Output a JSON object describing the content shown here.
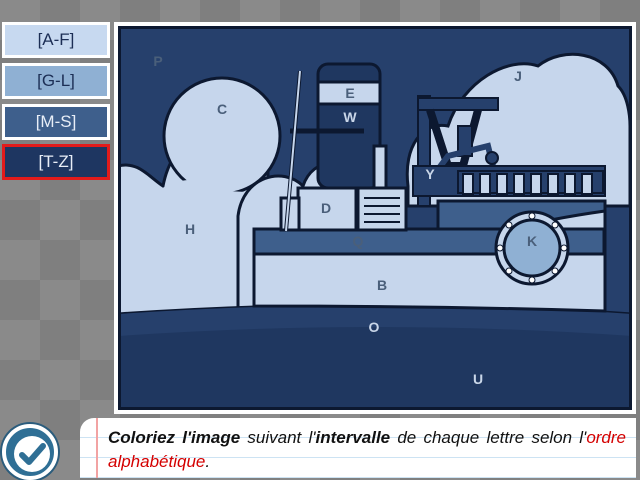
{
  "palette": {
    "buttons": [
      {
        "label": "[A-F]",
        "bg": "#c7d9f0",
        "fg": "#1c2e55",
        "border": "#ffffff"
      },
      {
        "label": "[G-L]",
        "bg": "#8fb0d3",
        "fg": "#1c2e55",
        "border": "#ffffff"
      },
      {
        "label": "[M-S]",
        "bg": "#3e5f8c",
        "fg": "#e8eef7",
        "border": "#ffffff"
      },
      {
        "label": "[T-Z]",
        "bg": "#1e3661",
        "fg": "#e8eef7",
        "border": "#e21b1b"
      }
    ],
    "selected_index": 3
  },
  "drawing": {
    "labels": {
      "P": "P",
      "C": "C",
      "E": "E",
      "W": "W",
      "J": "J",
      "Y": "Y",
      "H": "H",
      "D": "D",
      "Q": "Q",
      "K": "K",
      "B": "B",
      "O": "O",
      "U": "U"
    }
  },
  "colors": {
    "outline": "#0c1830",
    "sky": "#26406c",
    "cloud": "#c6d6ec",
    "sea": "#1f3760"
  },
  "instruction": {
    "part1": "Coloriez l'image",
    "part2": " suivant l'",
    "part3": "intervalle",
    "part4": " de chaque lettre selon l'",
    "part5": "ordre alphabétique",
    "part6": "."
  },
  "icons": {
    "validate": "checkmark-icon"
  }
}
